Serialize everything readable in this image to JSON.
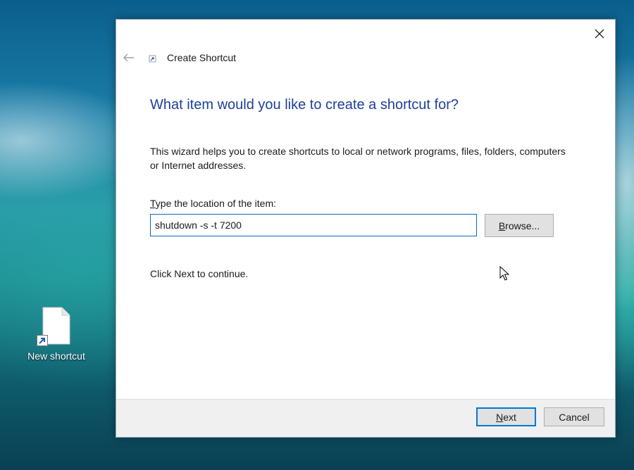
{
  "desktop": {
    "shortcut_icon_label": "New shortcut"
  },
  "dialog": {
    "title": "Create Shortcut",
    "heading": "What item would you like to create a shortcut for?",
    "description": "This wizard helps you to create shortcuts to local or network programs, files, folders, computers or Internet addresses.",
    "field_label_prefix": "T",
    "field_label_rest": "ype the location of the item:",
    "location_value": "shutdown -s -t 7200",
    "browse_prefix": "B",
    "browse_rest": "rowse...",
    "continue_text": "Click Next to continue.",
    "next_prefix": "N",
    "next_rest": "ext",
    "cancel_label": "Cancel"
  },
  "colors": {
    "heading": "#1f3f99",
    "accent": "#0078d7"
  },
  "icons": [
    "close-icon",
    "back-arrow-icon",
    "shortcut-wizard-icon",
    "document-icon",
    "shortcut-arrow-icon",
    "mouse-pointer-icon"
  ]
}
